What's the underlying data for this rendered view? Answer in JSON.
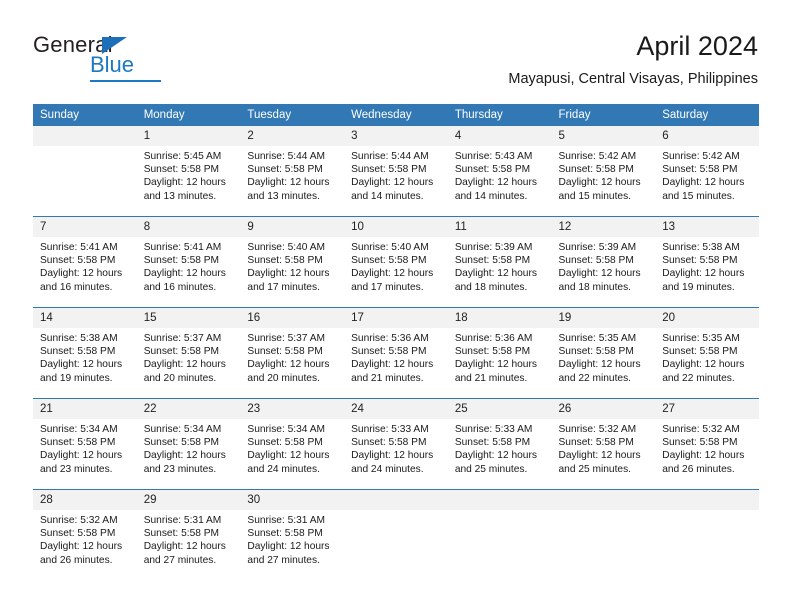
{
  "logo": {
    "word_one": "General",
    "word_two": "Blue",
    "triangle_icon": "triangle-icon",
    "accent_color": "#1d79c4"
  },
  "header": {
    "title": "April 2024",
    "subtitle": "Mayapusi, Central Visayas, Philippines"
  },
  "theme": {
    "header_blue": "#3178b4",
    "daynum_gray": "#f2f2f2",
    "text": "#1a1a1a"
  },
  "weekday_headers": [
    "Sunday",
    "Monday",
    "Tuesday",
    "Wednesday",
    "Thursday",
    "Friday",
    "Saturday"
  ],
  "labels": {
    "sunrise_prefix": "Sunrise:",
    "sunset_prefix": "Sunset:",
    "daylight_prefix": "Daylight:"
  },
  "weeks": [
    [
      {
        "day": "",
        "sunrise": "",
        "sunset": "",
        "daylight_line1": "",
        "daylight_line2": "",
        "empty": true
      },
      {
        "day": "1",
        "sunrise": "Sunrise: 5:45 AM",
        "sunset": "Sunset: 5:58 PM",
        "daylight_line1": "Daylight: 12 hours",
        "daylight_line2": "and 13 minutes."
      },
      {
        "day": "2",
        "sunrise": "Sunrise: 5:44 AM",
        "sunset": "Sunset: 5:58 PM",
        "daylight_line1": "Daylight: 12 hours",
        "daylight_line2": "and 13 minutes."
      },
      {
        "day": "3",
        "sunrise": "Sunrise: 5:44 AM",
        "sunset": "Sunset: 5:58 PM",
        "daylight_line1": "Daylight: 12 hours",
        "daylight_line2": "and 14 minutes."
      },
      {
        "day": "4",
        "sunrise": "Sunrise: 5:43 AM",
        "sunset": "Sunset: 5:58 PM",
        "daylight_line1": "Daylight: 12 hours",
        "daylight_line2": "and 14 minutes."
      },
      {
        "day": "5",
        "sunrise": "Sunrise: 5:42 AM",
        "sunset": "Sunset: 5:58 PM",
        "daylight_line1": "Daylight: 12 hours",
        "daylight_line2": "and 15 minutes."
      },
      {
        "day": "6",
        "sunrise": "Sunrise: 5:42 AM",
        "sunset": "Sunset: 5:58 PM",
        "daylight_line1": "Daylight: 12 hours",
        "daylight_line2": "and 15 minutes."
      }
    ],
    [
      {
        "day": "7",
        "sunrise": "Sunrise: 5:41 AM",
        "sunset": "Sunset: 5:58 PM",
        "daylight_line1": "Daylight: 12 hours",
        "daylight_line2": "and 16 minutes."
      },
      {
        "day": "8",
        "sunrise": "Sunrise: 5:41 AM",
        "sunset": "Sunset: 5:58 PM",
        "daylight_line1": "Daylight: 12 hours",
        "daylight_line2": "and 16 minutes."
      },
      {
        "day": "9",
        "sunrise": "Sunrise: 5:40 AM",
        "sunset": "Sunset: 5:58 PM",
        "daylight_line1": "Daylight: 12 hours",
        "daylight_line2": "and 17 minutes."
      },
      {
        "day": "10",
        "sunrise": "Sunrise: 5:40 AM",
        "sunset": "Sunset: 5:58 PM",
        "daylight_line1": "Daylight: 12 hours",
        "daylight_line2": "and 17 minutes."
      },
      {
        "day": "11",
        "sunrise": "Sunrise: 5:39 AM",
        "sunset": "Sunset: 5:58 PM",
        "daylight_line1": "Daylight: 12 hours",
        "daylight_line2": "and 18 minutes."
      },
      {
        "day": "12",
        "sunrise": "Sunrise: 5:39 AM",
        "sunset": "Sunset: 5:58 PM",
        "daylight_line1": "Daylight: 12 hours",
        "daylight_line2": "and 18 minutes."
      },
      {
        "day": "13",
        "sunrise": "Sunrise: 5:38 AM",
        "sunset": "Sunset: 5:58 PM",
        "daylight_line1": "Daylight: 12 hours",
        "daylight_line2": "and 19 minutes."
      }
    ],
    [
      {
        "day": "14",
        "sunrise": "Sunrise: 5:38 AM",
        "sunset": "Sunset: 5:58 PM",
        "daylight_line1": "Daylight: 12 hours",
        "daylight_line2": "and 19 minutes."
      },
      {
        "day": "15",
        "sunrise": "Sunrise: 5:37 AM",
        "sunset": "Sunset: 5:58 PM",
        "daylight_line1": "Daylight: 12 hours",
        "daylight_line2": "and 20 minutes."
      },
      {
        "day": "16",
        "sunrise": "Sunrise: 5:37 AM",
        "sunset": "Sunset: 5:58 PM",
        "daylight_line1": "Daylight: 12 hours",
        "daylight_line2": "and 20 minutes."
      },
      {
        "day": "17",
        "sunrise": "Sunrise: 5:36 AM",
        "sunset": "Sunset: 5:58 PM",
        "daylight_line1": "Daylight: 12 hours",
        "daylight_line2": "and 21 minutes."
      },
      {
        "day": "18",
        "sunrise": "Sunrise: 5:36 AM",
        "sunset": "Sunset: 5:58 PM",
        "daylight_line1": "Daylight: 12 hours",
        "daylight_line2": "and 21 minutes."
      },
      {
        "day": "19",
        "sunrise": "Sunrise: 5:35 AM",
        "sunset": "Sunset: 5:58 PM",
        "daylight_line1": "Daylight: 12 hours",
        "daylight_line2": "and 22 minutes."
      },
      {
        "day": "20",
        "sunrise": "Sunrise: 5:35 AM",
        "sunset": "Sunset: 5:58 PM",
        "daylight_line1": "Daylight: 12 hours",
        "daylight_line2": "and 22 minutes."
      }
    ],
    [
      {
        "day": "21",
        "sunrise": "Sunrise: 5:34 AM",
        "sunset": "Sunset: 5:58 PM",
        "daylight_line1": "Daylight: 12 hours",
        "daylight_line2": "and 23 minutes."
      },
      {
        "day": "22",
        "sunrise": "Sunrise: 5:34 AM",
        "sunset": "Sunset: 5:58 PM",
        "daylight_line1": "Daylight: 12 hours",
        "daylight_line2": "and 23 minutes."
      },
      {
        "day": "23",
        "sunrise": "Sunrise: 5:34 AM",
        "sunset": "Sunset: 5:58 PM",
        "daylight_line1": "Daylight: 12 hours",
        "daylight_line2": "and 24 minutes."
      },
      {
        "day": "24",
        "sunrise": "Sunrise: 5:33 AM",
        "sunset": "Sunset: 5:58 PM",
        "daylight_line1": "Daylight: 12 hours",
        "daylight_line2": "and 24 minutes."
      },
      {
        "day": "25",
        "sunrise": "Sunrise: 5:33 AM",
        "sunset": "Sunset: 5:58 PM",
        "daylight_line1": "Daylight: 12 hours",
        "daylight_line2": "and 25 minutes."
      },
      {
        "day": "26",
        "sunrise": "Sunrise: 5:32 AM",
        "sunset": "Sunset: 5:58 PM",
        "daylight_line1": "Daylight: 12 hours",
        "daylight_line2": "and 25 minutes."
      },
      {
        "day": "27",
        "sunrise": "Sunrise: 5:32 AM",
        "sunset": "Sunset: 5:58 PM",
        "daylight_line1": "Daylight: 12 hours",
        "daylight_line2": "and 26 minutes."
      }
    ],
    [
      {
        "day": "28",
        "sunrise": "Sunrise: 5:32 AM",
        "sunset": "Sunset: 5:58 PM",
        "daylight_line1": "Daylight: 12 hours",
        "daylight_line2": "and 26 minutes."
      },
      {
        "day": "29",
        "sunrise": "Sunrise: 5:31 AM",
        "sunset": "Sunset: 5:58 PM",
        "daylight_line1": "Daylight: 12 hours",
        "daylight_line2": "and 27 minutes."
      },
      {
        "day": "30",
        "sunrise": "Sunrise: 5:31 AM",
        "sunset": "Sunset: 5:58 PM",
        "daylight_line1": "Daylight: 12 hours",
        "daylight_line2": "and 27 minutes."
      },
      {
        "day": "",
        "sunrise": "",
        "sunset": "",
        "daylight_line1": "",
        "daylight_line2": "",
        "empty": true
      },
      {
        "day": "",
        "sunrise": "",
        "sunset": "",
        "daylight_line1": "",
        "daylight_line2": "",
        "empty": true
      },
      {
        "day": "",
        "sunrise": "",
        "sunset": "",
        "daylight_line1": "",
        "daylight_line2": "",
        "empty": true
      },
      {
        "day": "",
        "sunrise": "",
        "sunset": "",
        "daylight_line1": "",
        "daylight_line2": "",
        "empty": true
      }
    ]
  ]
}
